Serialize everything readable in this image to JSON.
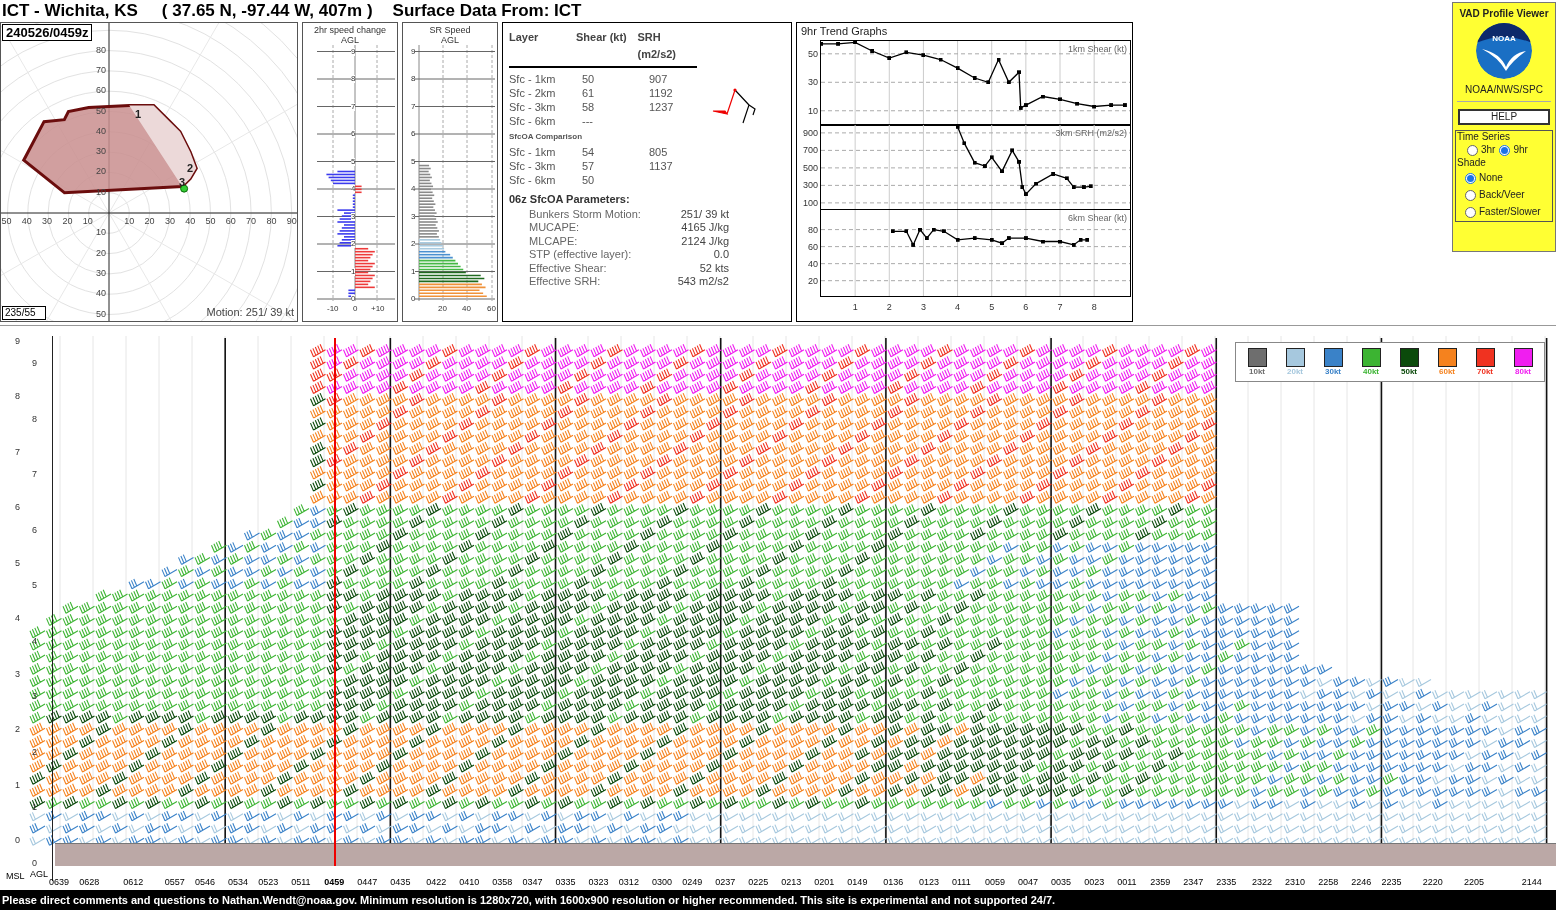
{
  "header": {
    "site": "ICT - Wichita, KS",
    "location": "( 37.65 N, -97.44 W, 407m )",
    "surface": "Surface Data From: ICT"
  },
  "hodograph": {
    "time": "240526/0459z",
    "mean_wind": "235/55",
    "motion": "Motion: 251/ 39 kt",
    "left_labels": [
      "50",
      "40",
      "30",
      "20",
      "10"
    ],
    "right_labels": [
      "10",
      "20",
      "30",
      "40",
      "50",
      "60",
      "70",
      "80",
      "90"
    ],
    "up_labels": [
      "80",
      "70",
      "60",
      "50",
      "40",
      "30",
      "20",
      "10"
    ],
    "down_labels": [
      "10",
      "20",
      "30",
      "40",
      "50"
    ],
    "height_marks": [
      "1",
      "2",
      "3"
    ]
  },
  "speed_change": {
    "title": "2hr speed change",
    "subtitle": "AGL",
    "height_labels": [
      "9",
      "8",
      "7",
      "6",
      "5",
      "4",
      "3",
      "2",
      "1",
      "0"
    ],
    "x_labels": [
      "-10",
      "0",
      "+10"
    ]
  },
  "sr_speed": {
    "title": "SR Speed",
    "subtitle": "AGL",
    "height_labels": [
      "9",
      "8",
      "7",
      "6",
      "5",
      "4",
      "3",
      "2",
      "1",
      "0"
    ],
    "x_labels": [
      "20",
      "40",
      "60"
    ]
  },
  "shear_table": {
    "columns": [
      "Layer",
      "Shear (kt)",
      "SRH (m2/s2)"
    ],
    "rows": [
      {
        "layer": "Sfc - 1km",
        "shear": "50",
        "srh": "907"
      },
      {
        "layer": "Sfc - 2km",
        "shear": "61",
        "srh": "1192"
      },
      {
        "layer": "Sfc - 3km",
        "shear": "58",
        "srh": "1237"
      },
      {
        "layer": "Sfc - 6km",
        "shear": "---"
      }
    ],
    "comparison_title": "SfcOA Comparison",
    "comparison_rows": [
      {
        "layer": "Sfc - 1km",
        "shear": "54",
        "srh": "805"
      },
      {
        "layer": "Sfc - 3km",
        "shear": "57",
        "srh": "1137"
      },
      {
        "layer": "Sfc - 6km",
        "shear": "50"
      }
    ],
    "params_title": "06z SfcOA Parameters:",
    "params": [
      {
        "label": "Bunkers Storm Motion:",
        "value": "251/ 39 kt"
      },
      {
        "label": "MUCAPE:",
        "value": "4165 J/kg"
      },
      {
        "label": "MLCAPE:",
        "value": "2124 J/kg"
      },
      {
        "label": "STP (effective layer):",
        "value": "0.0"
      },
      {
        "label": "Effective Shear:",
        "value": "52 kts"
      },
      {
        "label": "Effective SRH:",
        "value": "543 m2/s2"
      }
    ]
  },
  "trends": {
    "title": "9hr Trend Graphs",
    "charts": [
      {
        "chart_data": {
          "type": "line",
          "title": "1km Shear (kt)",
          "grid": true,
          "xlim": [
            0,
            9.05
          ],
          "ylim": [
            0,
            59
          ],
          "yticks": [
            10,
            30,
            50
          ],
          "x": [
            0,
            0.5,
            1,
            1.5,
            2,
            2.5,
            3,
            3.5,
            4,
            4.5,
            4.9,
            5.2,
            5.5,
            5.8,
            5.85,
            6,
            6.5,
            7,
            7.5,
            8,
            8.5,
            8.9
          ],
          "series": [
            {
              "color": "#000000",
              "values": [
                57,
                57,
                58,
                52,
                47,
                51,
                49,
                46,
                40,
                33,
                30,
                46,
                30,
                37,
                12,
                14,
                20,
                18,
                15,
                13,
                14,
                14
              ]
            }
          ]
        }
      },
      {
        "chart_data": {
          "type": "line",
          "title": "3km SRH (m2/s2)",
          "grid": true,
          "xlim": [
            0,
            9.05
          ],
          "ylim": [
            30,
            990
          ],
          "yticks": [
            100,
            300,
            500,
            700,
            900
          ],
          "x": [
            4,
            4.2,
            4.5,
            4.8,
            5,
            5.3,
            5.6,
            5.8,
            5.9,
            6,
            6.3,
            6.8,
            7.2,
            7.4,
            7.7,
            7.9
          ],
          "series": [
            {
              "color": "#000000",
              "values": [
                970,
                780,
                560,
                520,
                620,
                460,
                700,
                570,
                280,
                200,
                320,
                430,
                380,
                280,
                280,
                290
              ]
            }
          ]
        }
      },
      {
        "chart_data": {
          "type": "line",
          "title": "6km Shear (kt)",
          "grid": true,
          "xlim": [
            0,
            9.05
          ],
          "ylim": [
            2,
            103
          ],
          "yticks": [
            20,
            40,
            60,
            80
          ],
          "xticks": [
            1,
            2,
            3,
            4,
            5,
            6,
            7,
            8
          ],
          "x": [
            2.1,
            2.5,
            2.7,
            2.9,
            3.1,
            3.3,
            3.6,
            4,
            4.5,
            5,
            5.3,
            5.5,
            6,
            6.5,
            7,
            7.4,
            7.6,
            7.8
          ],
          "series": [
            {
              "color": "#000000",
              "values": [
                78,
                78,
                62,
                80,
                70,
                80,
                78,
                68,
                70,
                68,
                64,
                70,
                70,
                66,
                66,
                62,
                68,
                68
              ]
            }
          ]
        }
      }
    ]
  },
  "sidebar": {
    "title": "VAD Profile Viewer",
    "logo_text": "NOAA",
    "org": "NOAA/NWS/SPC",
    "help": "HELP",
    "time_series_label": "Time Series",
    "time_series": [
      {
        "label": "3hr",
        "selected": false
      },
      {
        "label": "9hr",
        "selected": true
      }
    ],
    "shade_label": "Shade",
    "shade": [
      {
        "label": "None",
        "selected": true
      },
      {
        "label": "Back/Veer",
        "selected": false
      },
      {
        "label": "Faster/Slower",
        "selected": false
      }
    ]
  },
  "time_height": {
    "msl_title": "MSL",
    "agl_title": "AGL",
    "msl_heights": [
      "9",
      "8",
      "7",
      "6",
      "5",
      "4",
      "3",
      "2",
      "1",
      "0"
    ],
    "agl_heights": [
      "9",
      "8",
      "7",
      "6",
      "5",
      "4",
      "3",
      "2",
      "1",
      "0"
    ],
    "times": [
      {
        "label": "0639",
        "selected": false
      },
      {
        "label": "0628",
        "selected": false
      },
      {
        "label": "0612",
        "selected": false
      },
      {
        "label": "0557",
        "selected": false
      },
      {
        "label": "0546",
        "selected": false
      },
      {
        "label": "0534",
        "selected": false
      },
      {
        "label": "0523",
        "selected": false
      },
      {
        "label": "0511",
        "selected": false
      },
      {
        "label": "0459",
        "selected": true
      },
      {
        "label": "0447",
        "selected": false
      },
      {
        "label": "0435",
        "selected": false
      },
      {
        "label": "0422",
        "selected": false
      },
      {
        "label": "0410",
        "selected": false
      },
      {
        "label": "0358",
        "selected": false
      },
      {
        "label": "0347",
        "selected": false
      },
      {
        "label": "0335",
        "selected": false
      },
      {
        "label": "0323",
        "selected": false
      },
      {
        "label": "0312",
        "selected": false
      },
      {
        "label": "0300",
        "selected": false
      },
      {
        "label": "0249",
        "selected": false
      },
      {
        "label": "0237",
        "selected": false
      },
      {
        "label": "0225",
        "selected": false
      },
      {
        "label": "0213",
        "selected": false
      },
      {
        "label": "0201",
        "selected": false
      },
      {
        "label": "0149",
        "selected": false
      },
      {
        "label": "0136",
        "selected": false
      },
      {
        "label": "0123",
        "selected": false
      },
      {
        "label": "0111",
        "selected": false
      },
      {
        "label": "0059",
        "selected": false
      },
      {
        "label": "0047",
        "selected": false
      },
      {
        "label": "0035",
        "selected": false
      },
      {
        "label": "0023",
        "selected": false
      },
      {
        "label": "0011",
        "selected": false
      },
      {
        "label": "2359",
        "selected": false
      },
      {
        "label": "2347",
        "selected": false
      },
      {
        "label": "2335",
        "selected": false
      },
      {
        "label": "2322",
        "selected": false
      },
      {
        "label": "2310",
        "selected": false
      },
      {
        "label": "2258",
        "selected": false
      },
      {
        "label": "2246",
        "selected": false
      },
      {
        "label": "2235",
        "selected": false
      },
      {
        "label": "2220",
        "selected": false
      },
      {
        "label": "2205",
        "selected": false
      },
      {
        "label": "2144",
        "selected": false
      }
    ],
    "legend": [
      {
        "label": "10kt",
        "color": "#6e6e6e"
      },
      {
        "label": "20kt",
        "color": "#a6c8de"
      },
      {
        "label": "30kt",
        "color": "#3a82c8"
      },
      {
        "label": "40kt",
        "color": "#3cb432"
      },
      {
        "label": "50kt",
        "color": "#0b4a0b"
      },
      {
        "label": "60kt",
        "color": "#f5821e"
      },
      {
        "label": "70kt",
        "color": "#f03220"
      },
      {
        "label": "80kt",
        "color": "#f01ef0"
      }
    ]
  },
  "footer": "Please direct comments and questions to Nathan.Wendt@noaa.gov. Minimum resolution is 1280x720, with 1600x900 resolution or higher recommended. This site is experimental and not supported 24/7."
}
